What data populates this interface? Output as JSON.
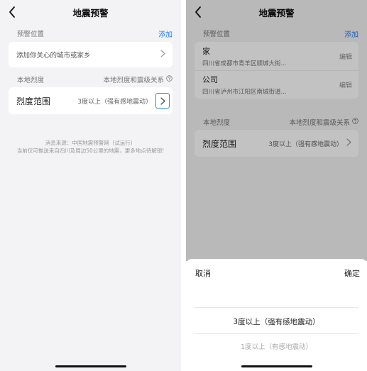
{
  "left": {
    "nav": {
      "title": "地震预警"
    },
    "warning_location": {
      "label": "预警位置",
      "add_label": "添加",
      "placeholder_row": "添加你关心的城市或家乡"
    },
    "local_intensity": {
      "label": "本地烈度",
      "relation_label": "本地烈度和震级关系",
      "range_label": "烈度范围",
      "range_value": "3度以上（强有感地震动）"
    },
    "source_note": {
      "line1": "消息来源：中国地震预警网（试运行）",
      "line2": "当前仅可推送来自四川及周边50公里的地震，更多地点待解锁!"
    }
  },
  "right": {
    "nav": {
      "title": "地震预警"
    },
    "warning_location": {
      "label": "预警位置",
      "add_label": "添加",
      "items": [
        {
          "name": "家",
          "address": "四川省成都市青羊区顺城大街...",
          "edit_label": "编辑"
        },
        {
          "name": "公司",
          "address": "四川省泸州市江阳区南城街道...",
          "edit_label": "编辑"
        }
      ]
    },
    "local_intensity": {
      "label": "本地烈度",
      "relation_label": "本地烈度和震级关系",
      "range_label": "烈度范围",
      "range_value": "3度以上（强有感地震动）"
    },
    "picker": {
      "cancel_label": "取消",
      "confirm_label": "确定",
      "options": [
        "3度以上（强有感地震动）",
        "1度以上（有感地震动）"
      ],
      "selected_index": 0
    }
  },
  "colors": {
    "accent": "#2b7de9",
    "background": "#f3f3f5",
    "card": "#ffffff",
    "overlay": "rgba(0,0,0,0.24)"
  },
  "icons": [
    "back-arrow-icon",
    "chevron-right-icon",
    "help-circle-icon"
  ]
}
